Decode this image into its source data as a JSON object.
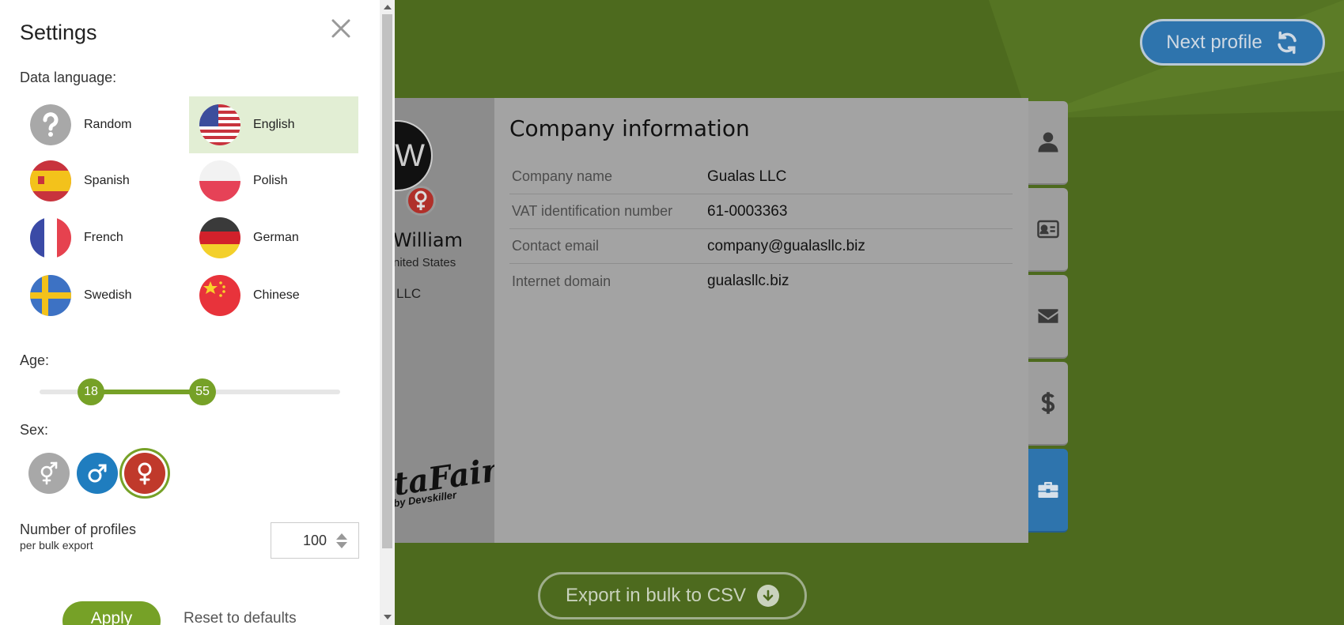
{
  "colors": {
    "background": "#4d6a1e",
    "accent_green": "#76a127",
    "accent_blue": "#2e74ad",
    "female_red": "#c0392b",
    "selected_lang_bg": "#e2eed4"
  },
  "settings": {
    "title": "Settings",
    "close_icon": "close-icon",
    "data_language_label": "Data language:",
    "languages": [
      {
        "name": "Random",
        "icon": "question-icon",
        "selected": false
      },
      {
        "name": "English",
        "icon": "us-flag-icon",
        "selected": true
      },
      {
        "name": "Spanish",
        "icon": "spain-flag-icon",
        "selected": false
      },
      {
        "name": "Polish",
        "icon": "poland-flag-icon",
        "selected": false
      },
      {
        "name": "French",
        "icon": "france-flag-icon",
        "selected": false
      },
      {
        "name": "German",
        "icon": "germany-flag-icon",
        "selected": false
      },
      {
        "name": "Swedish",
        "icon": "sweden-flag-icon",
        "selected": false
      },
      {
        "name": "Chinese",
        "icon": "china-flag-icon",
        "selected": false
      }
    ],
    "age_label": "Age:",
    "age_min": "18",
    "age_max": "55",
    "sex_label": "Sex:",
    "sex_options": [
      {
        "icon": "both-genders-icon",
        "selected": false
      },
      {
        "icon": "male-icon",
        "selected": false
      },
      {
        "icon": "female-icon",
        "selected": true
      }
    ],
    "profiles_label": "Number of profiles",
    "profiles_sublabel": "per bulk export",
    "profiles_value": "100",
    "apply_label": "Apply",
    "reset_label": "Reset to defaults"
  },
  "header": {
    "next_profile_label": "Next profile"
  },
  "profile_card": {
    "avatar_initial": "W",
    "name": "William",
    "country": "nited States",
    "company_short": "LLC",
    "logo_text": "taFairy",
    "logo_sub": "by Devskiller",
    "section_title": "Company information",
    "rows": [
      {
        "label": "Company name",
        "value": "Gualas LLC"
      },
      {
        "label": "VAT identification number",
        "value": "61-0003363"
      },
      {
        "label": "Contact email",
        "value": "company@gualasllc.biz"
      },
      {
        "label": "Internet domain",
        "value": "gualasllc.biz"
      }
    ],
    "tabs": [
      {
        "icon": "user-icon",
        "active": false
      },
      {
        "icon": "id-card-icon",
        "active": false
      },
      {
        "icon": "envelope-icon",
        "active": false
      },
      {
        "icon": "dollar-icon",
        "active": false
      },
      {
        "icon": "briefcase-icon",
        "active": true
      }
    ]
  },
  "footer": {
    "export_label": "Export in bulk to CSV"
  }
}
